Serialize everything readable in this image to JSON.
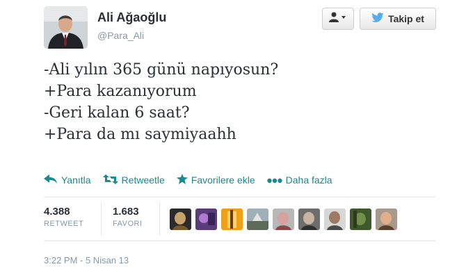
{
  "author": {
    "name": "Ali Ağaoğlu",
    "handle": "@Para_Ali"
  },
  "buttons": {
    "follow_label": "Takip et",
    "user_menu_icon": "user-dropdown-icon",
    "follow_icon": "twitter-bird-icon"
  },
  "tweet": {
    "lines": [
      "-Ali yılın 365 günü napıyosun?",
      "+Para kazanıyorum",
      "-Geri kalan 6 saat?",
      "+Para da mı saymiyaahh"
    ]
  },
  "actions": {
    "reply": "Yanıtla",
    "retweet": "Retweetle",
    "favorite": "Favorilere ekle",
    "more": "Daha fazla"
  },
  "stats": {
    "retweets_value": "4.388",
    "retweets_label": "RETWEET",
    "favorites_value": "1.683",
    "favorites_label": "FAVORI"
  },
  "timestamp": "3:22 PM - 5 Nisan 13",
  "colors": {
    "action": "#1a8a90",
    "twitter_blue": "#55acee",
    "muted": "#8899a6"
  }
}
